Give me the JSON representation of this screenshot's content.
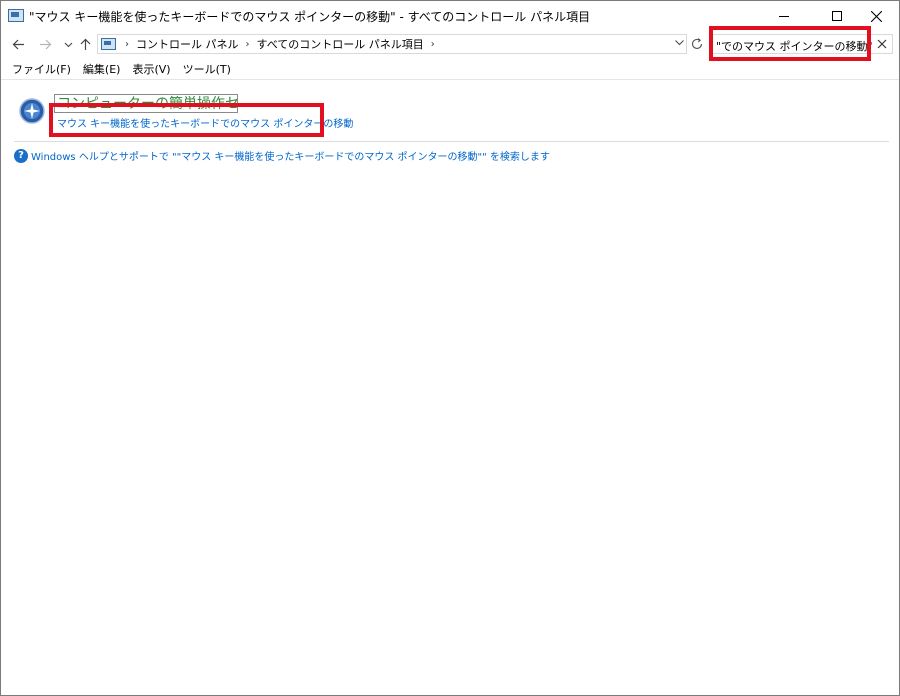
{
  "window": {
    "title": "\"マウス キー機能を使ったキーボードでのマウス ポインターの移動\" - すべてのコントロール パネル項目"
  },
  "address": {
    "breadcrumbs": [
      "コントロール パネル",
      "すべてのコントロール パネル項目"
    ]
  },
  "search": {
    "value": "\"でのマウス ポインターの移動\""
  },
  "menu": {
    "items": [
      "ファイル(F)",
      "編集(E)",
      "表示(V)",
      "ツール(T)"
    ]
  },
  "content": {
    "category_title": "コンピューターの簡単操作センター",
    "result_link": "マウス キー機能を使ったキーボードでのマウス ポインターの移動",
    "help_link": "Windows ヘルプとサポートで \"\"マウス キー機能を使ったキーボードでのマウス ポインターの移動\"\" を検索します"
  },
  "colors": {
    "link": "#0066cc",
    "category_title": "#2e8b3a",
    "highlight": "#e01020"
  }
}
